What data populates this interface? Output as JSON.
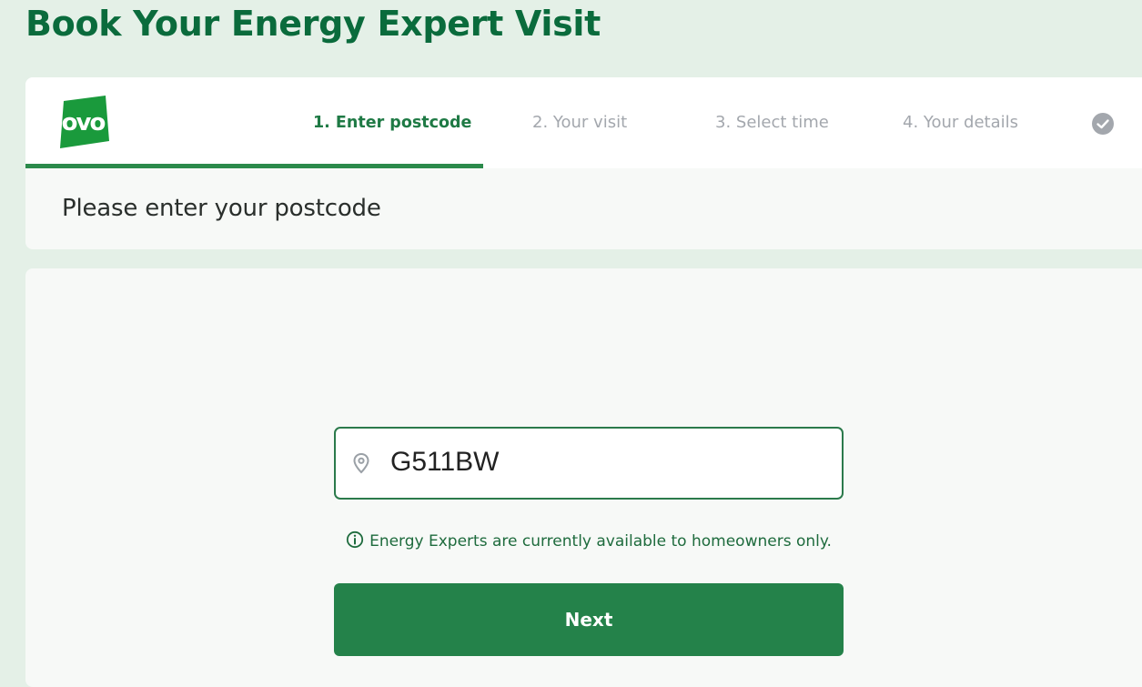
{
  "page": {
    "title": "Book Your Energy Expert Visit"
  },
  "brand": {
    "logo_text": "ovo",
    "primary_color": "#24824a",
    "title_color": "#0a6b3c",
    "logo_color": "#1a9a3c"
  },
  "stepper": {
    "steps": [
      {
        "label": "1. Enter postcode",
        "state": "active"
      },
      {
        "label": "2. Your visit",
        "state": "upcoming"
      },
      {
        "label": "3. Select time",
        "state": "upcoming"
      },
      {
        "label": "4. Your details",
        "state": "upcoming"
      }
    ],
    "complete_icon": "check-circle-icon",
    "progress_fraction": 0.4
  },
  "form": {
    "heading": "Please enter your postcode",
    "postcode_value": "G511BW",
    "postcode_icon": "map-pin-icon",
    "notice_icon": "info-icon",
    "notice": "Energy Experts are currently available to homeowners only.",
    "next_label": "Next"
  }
}
